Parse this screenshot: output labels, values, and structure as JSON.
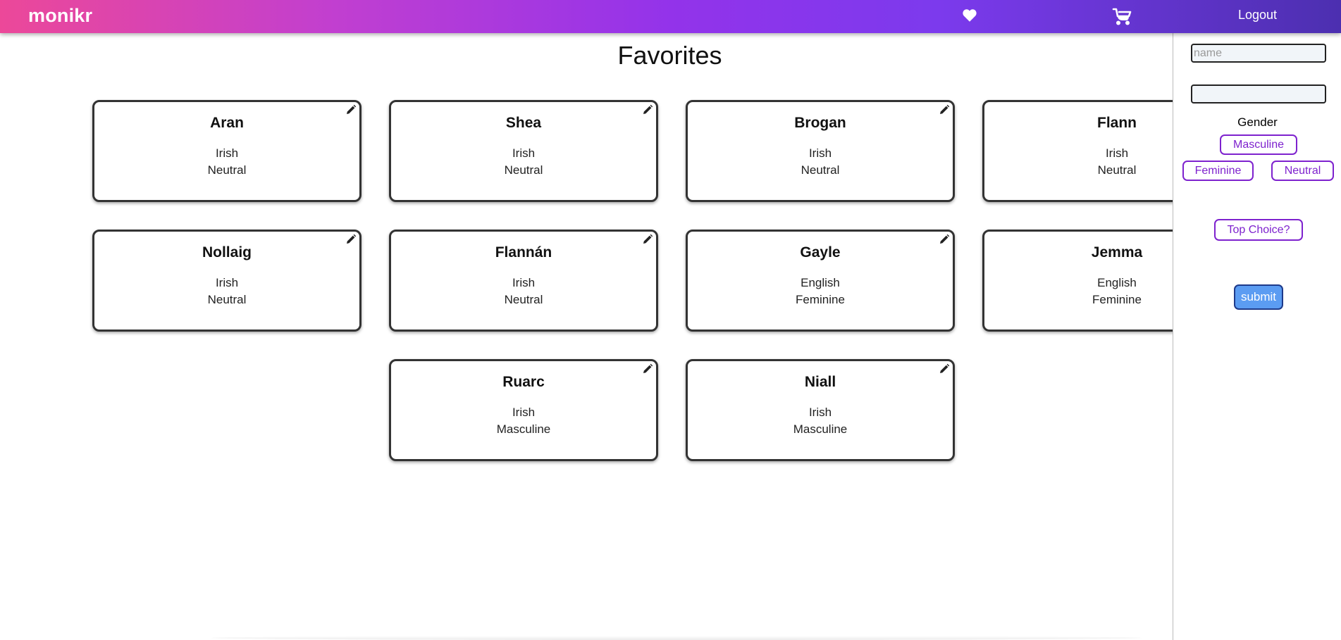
{
  "navbar": {
    "logo": "monikr",
    "favorites_icon": "heart-icon",
    "cart_icon": "baby-carriage-icon",
    "logout_label": "Logout",
    "gradient": [
      "#ec4899",
      "#9333ea",
      "#4c2fb0"
    ]
  },
  "page": {
    "title": "Favorites"
  },
  "cards": [
    {
      "name": "Aran",
      "origin": "Irish",
      "gender": "Neutral"
    },
    {
      "name": "Shea",
      "origin": "Irish",
      "gender": "Neutral"
    },
    {
      "name": "Brogan",
      "origin": "Irish",
      "gender": "Neutral"
    },
    {
      "name": "Flann",
      "origin": "Irish",
      "gender": "Neutral"
    },
    {
      "name": "Nollaig",
      "origin": "Irish",
      "gender": "Neutral"
    },
    {
      "name": "Flannán",
      "origin": "Irish",
      "gender": "Neutral"
    },
    {
      "name": "Gayle",
      "origin": "English",
      "gender": "Feminine"
    },
    {
      "name": "Jemma",
      "origin": "English",
      "gender": "Feminine"
    },
    {
      "name": "Ruarc",
      "origin": "Irish",
      "gender": "Masculine"
    },
    {
      "name": "Niall",
      "origin": "Irish",
      "gender": "Masculine"
    }
  ],
  "sidebar": {
    "name_input": {
      "placeholder": "name",
      "value": ""
    },
    "second_input": {
      "placeholder": "",
      "value": ""
    },
    "gender_label": "Gender",
    "gender_options": [
      "Masculine",
      "Feminine",
      "Neutral"
    ],
    "top_choice_label": "Top Choice?",
    "submit_label": "submit",
    "accent_color": "#7e22ce",
    "submit_color": "#5b9cf2"
  }
}
